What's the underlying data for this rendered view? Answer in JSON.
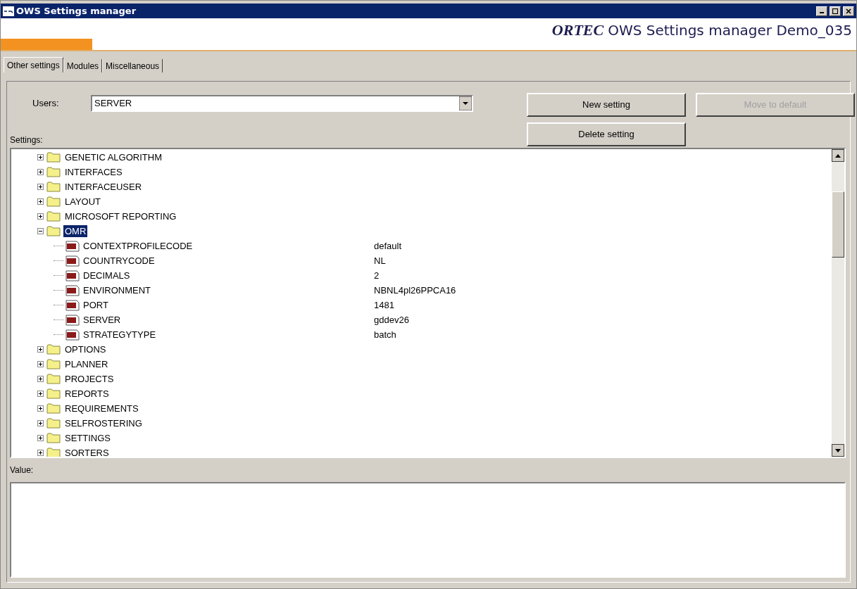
{
  "window": {
    "title": "OWS Settings manager"
  },
  "header": {
    "logo": "ORTEC",
    "title": "OWS Settings manager Demo_035"
  },
  "tabs": [
    {
      "label": "Other settings",
      "selected": true
    },
    {
      "label": "Modules",
      "selected": false
    },
    {
      "label": "Miscellaneous",
      "selected": false
    }
  ],
  "users": {
    "label": "Users:",
    "value": "SERVER"
  },
  "buttons": [
    {
      "label": "New setting",
      "disabled": false
    },
    {
      "label": "Move to default",
      "disabled": true
    },
    {
      "label": "Delete setting",
      "disabled": false
    }
  ],
  "settings": {
    "label": "Settings:",
    "items": [
      {
        "kind": "folder",
        "name": "GENETIC ALGORITHM",
        "expanded": false,
        "selected": false
      },
      {
        "kind": "folder",
        "name": "INTERFACES",
        "expanded": false,
        "selected": false
      },
      {
        "kind": "folder",
        "name": "INTERFACEUSER",
        "expanded": false,
        "selected": false
      },
      {
        "kind": "folder",
        "name": "LAYOUT",
        "expanded": false,
        "selected": false
      },
      {
        "kind": "folder",
        "name": "MICROSOFT REPORTING",
        "expanded": false,
        "selected": false
      },
      {
        "kind": "folder",
        "name": "OMR",
        "expanded": true,
        "selected": true,
        "children": [
          {
            "kind": "value",
            "name": "CONTEXTPROFILECODE",
            "value": "default",
            "selected": false
          },
          {
            "kind": "value",
            "name": "COUNTRYCODE",
            "value": "NL",
            "selected": false
          },
          {
            "kind": "value",
            "name": "DECIMALS",
            "value": "2",
            "selected": false
          },
          {
            "kind": "value",
            "name": "ENVIRONMENT",
            "value": "NBNL4pl26PPCA16",
            "selected": false
          },
          {
            "kind": "value",
            "name": "PORT",
            "value": "1481",
            "selected": false
          },
          {
            "kind": "value",
            "name": "SERVER",
            "value": "gddev26",
            "selected": false
          },
          {
            "kind": "value",
            "name": "STRATEGYTYPE",
            "value": "batch",
            "selected": false
          }
        ]
      },
      {
        "kind": "folder",
        "name": "OPTIONS",
        "expanded": false,
        "selected": false
      },
      {
        "kind": "folder",
        "name": "PLANNER",
        "expanded": false,
        "selected": false
      },
      {
        "kind": "folder",
        "name": "PROJECTS",
        "expanded": false,
        "selected": false
      },
      {
        "kind": "folder",
        "name": "REPORTS",
        "expanded": false,
        "selected": false
      },
      {
        "kind": "folder",
        "name": "REQUIREMENTS",
        "expanded": false,
        "selected": false
      },
      {
        "kind": "folder",
        "name": "SELFROSTERING",
        "expanded": false,
        "selected": false
      },
      {
        "kind": "folder",
        "name": "SETTINGS",
        "expanded": false,
        "selected": false
      },
      {
        "kind": "folder",
        "name": "SORTERS",
        "expanded": false,
        "selected": false
      }
    ]
  },
  "value": {
    "label": "Value:"
  }
}
